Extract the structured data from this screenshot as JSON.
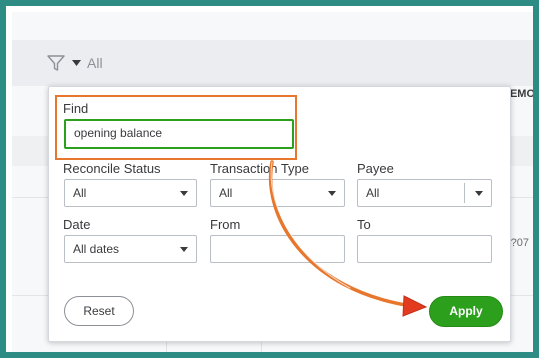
{
  "toolbar": {
    "filter_label": "All"
  },
  "table_background": {
    "header_memo": "EMO",
    "cell_partial": "?07"
  },
  "filter_panel": {
    "find": {
      "label": "Find",
      "value": "opening balance"
    },
    "reconcile_status": {
      "label": "Reconcile Status",
      "value": "All"
    },
    "transaction_type": {
      "label": "Transaction Type",
      "value": "All"
    },
    "payee": {
      "label": "Payee",
      "value": "All"
    },
    "date": {
      "label": "Date",
      "value": "All dates"
    },
    "from": {
      "label": "From",
      "value": ""
    },
    "to": {
      "label": "To",
      "value": ""
    },
    "reset_label": "Reset",
    "apply_label": "Apply"
  },
  "colors": {
    "frame": "#2d8c84",
    "highlight": "#e8772e",
    "apply": "#2ca01c",
    "arrow_red": "#e23b1f"
  },
  "icons": {
    "filter": "funnel-icon",
    "dropdown": "caret-down-icon"
  }
}
